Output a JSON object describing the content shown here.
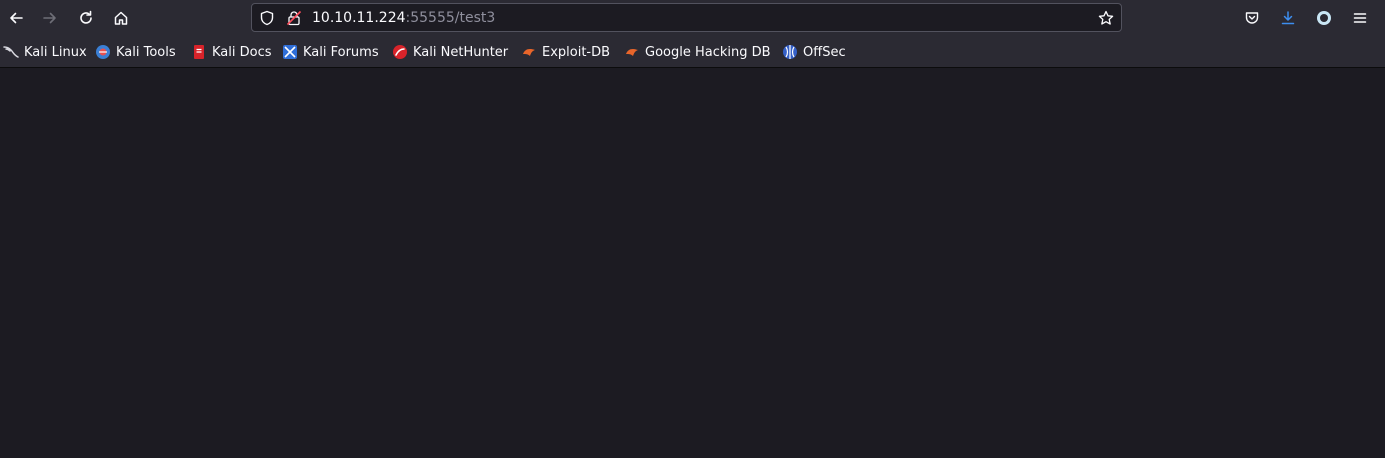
{
  "url": {
    "host": "10.10.11.224",
    "rest": ":55555/test3"
  },
  "bookmarks": [
    {
      "label": "Kali Linux",
      "icon": "kali-dragon-icon"
    },
    {
      "label": "Kali Tools",
      "icon": "kali-tools-icon"
    },
    {
      "label": "Kali Docs",
      "icon": "kali-docs-icon"
    },
    {
      "label": "Kali Forums",
      "icon": "kali-forums-icon"
    },
    {
      "label": "Kali NetHunter",
      "icon": "kali-nethunter-icon"
    },
    {
      "label": "Exploit-DB",
      "icon": "exploit-db-icon"
    },
    {
      "label": "Google Hacking DB",
      "icon": "exploit-db-icon"
    },
    {
      "label": "OffSec",
      "icon": "offsec-icon"
    }
  ],
  "colors": {
    "toolbar": "#2b2a33",
    "content": "#1c1b22",
    "accent": "#0df",
    "download_accent": "#3d8ef0"
  }
}
